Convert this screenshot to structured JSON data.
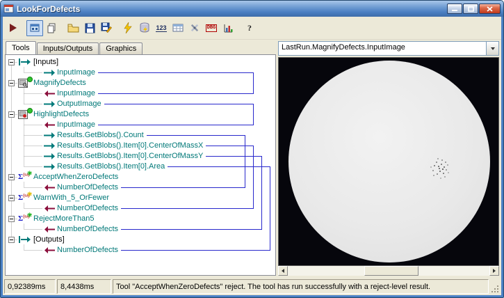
{
  "window": {
    "title": "LookForDefects"
  },
  "titlebar": {
    "controls": [
      "minimize-icon",
      "maximize-icon",
      "close-icon"
    ]
  },
  "toolbar": {
    "items": [
      {
        "name": "run"
      },
      {
        "name": "toolgroup",
        "pressed": true,
        "gap": true
      },
      {
        "name": "new-tool"
      },
      {
        "name": "open",
        "gap": true
      },
      {
        "name": "save"
      },
      {
        "name": "save-as"
      },
      {
        "name": "zap",
        "gap": true
      },
      {
        "name": "database"
      },
      {
        "name": "calc-123"
      },
      {
        "name": "grid"
      },
      {
        "name": "tools"
      },
      {
        "name": "debug"
      },
      {
        "name": "chart"
      },
      {
        "name": "help",
        "gap": true
      }
    ]
  },
  "tabs": {
    "items": [
      {
        "label": "Tools",
        "active": true
      },
      {
        "label": "Inputs/Outputs",
        "active": false
      },
      {
        "label": "Graphics",
        "active": false
      }
    ]
  },
  "tree": {
    "items": [
      {
        "label": "[Inputs]",
        "level": 0,
        "icon": "port-arrow",
        "expand": true
      },
      {
        "label": "InputImage",
        "level": 1,
        "icon": "out-arrow"
      },
      {
        "label": "MagnifyDefects",
        "level": 0,
        "icon": "image-tool",
        "badge": "dot-green",
        "expand": true
      },
      {
        "label": "InputImage",
        "level": 1,
        "icon": "in-arrow"
      },
      {
        "label": "OutputImage",
        "level": 1,
        "icon": "out-arrow"
      },
      {
        "label": "HighlightDefects",
        "level": 0,
        "icon": "image-tool-red",
        "badge": "dot-green",
        "expand": true
      },
      {
        "label": "InputImage",
        "level": 1,
        "icon": "in-arrow"
      },
      {
        "label": "Results.GetBlobs().Count",
        "level": 1,
        "icon": "out-arrow"
      },
      {
        "label": "Results.GetBlobs().Item[0].CenterOfMassX",
        "level": 1,
        "icon": "out-arrow"
      },
      {
        "label": "Results.GetBlobs().Item[0].CenterOfMassY",
        "level": 1,
        "icon": "out-arrow"
      },
      {
        "label": "Results.GetBlobs().Item[0].Area",
        "level": 1,
        "icon": "out-arrow"
      },
      {
        "label": "AcceptWhenZeroDefects",
        "level": 0,
        "icon": "sigma",
        "badge": "star-green",
        "expand": true
      },
      {
        "label": "NumberOfDefects",
        "level": 1,
        "icon": "in-arrow"
      },
      {
        "label": "WarnWith_5_OrFewer",
        "level": 0,
        "icon": "sigma",
        "badge": "star-yellow",
        "expand": true
      },
      {
        "label": "NumberOfDefects",
        "level": 1,
        "icon": "in-arrow"
      },
      {
        "label": "RejectMoreThan5",
        "level": 0,
        "icon": "sigma",
        "badge": "star-green",
        "expand": true
      },
      {
        "label": "NumberOfDefects",
        "level": 1,
        "icon": "in-arrow"
      },
      {
        "label": "[Outputs]",
        "level": 0,
        "icon": "port-arrow",
        "expand": true
      },
      {
        "label": "NumberOfDefects",
        "level": 1,
        "icon": "in-arrow"
      }
    ],
    "connections": [
      {
        "from": 1,
        "to": 3,
        "slot": 1
      },
      {
        "from": 4,
        "to": 6,
        "slot": 1
      },
      {
        "from": 7,
        "to": 12,
        "slot": 0
      },
      {
        "from": 8,
        "to": 14,
        "slot": 1
      },
      {
        "from": 9,
        "to": 16,
        "slot": 2
      },
      {
        "from": 10,
        "to": 18,
        "slot": 3
      }
    ]
  },
  "display": {
    "source_value": "LastRun.MagnifyDefects.InputImage",
    "image": {
      "content": "gray circular sample disc on black background with a small dark defect speckle cluster right of center"
    }
  },
  "statusbar": {
    "time1": "0,92389ms",
    "time2": "8,4438ms",
    "message": "Tool \"AcceptWhenZeroDefects\" reject. The tool has run successfully with a reject-level result."
  },
  "colors": {
    "out_arrow": "#007a7a",
    "in_arrow": "#8b0f3c",
    "connector": "#2828cc",
    "tool_text": "#007878",
    "group_text": "#000000"
  }
}
